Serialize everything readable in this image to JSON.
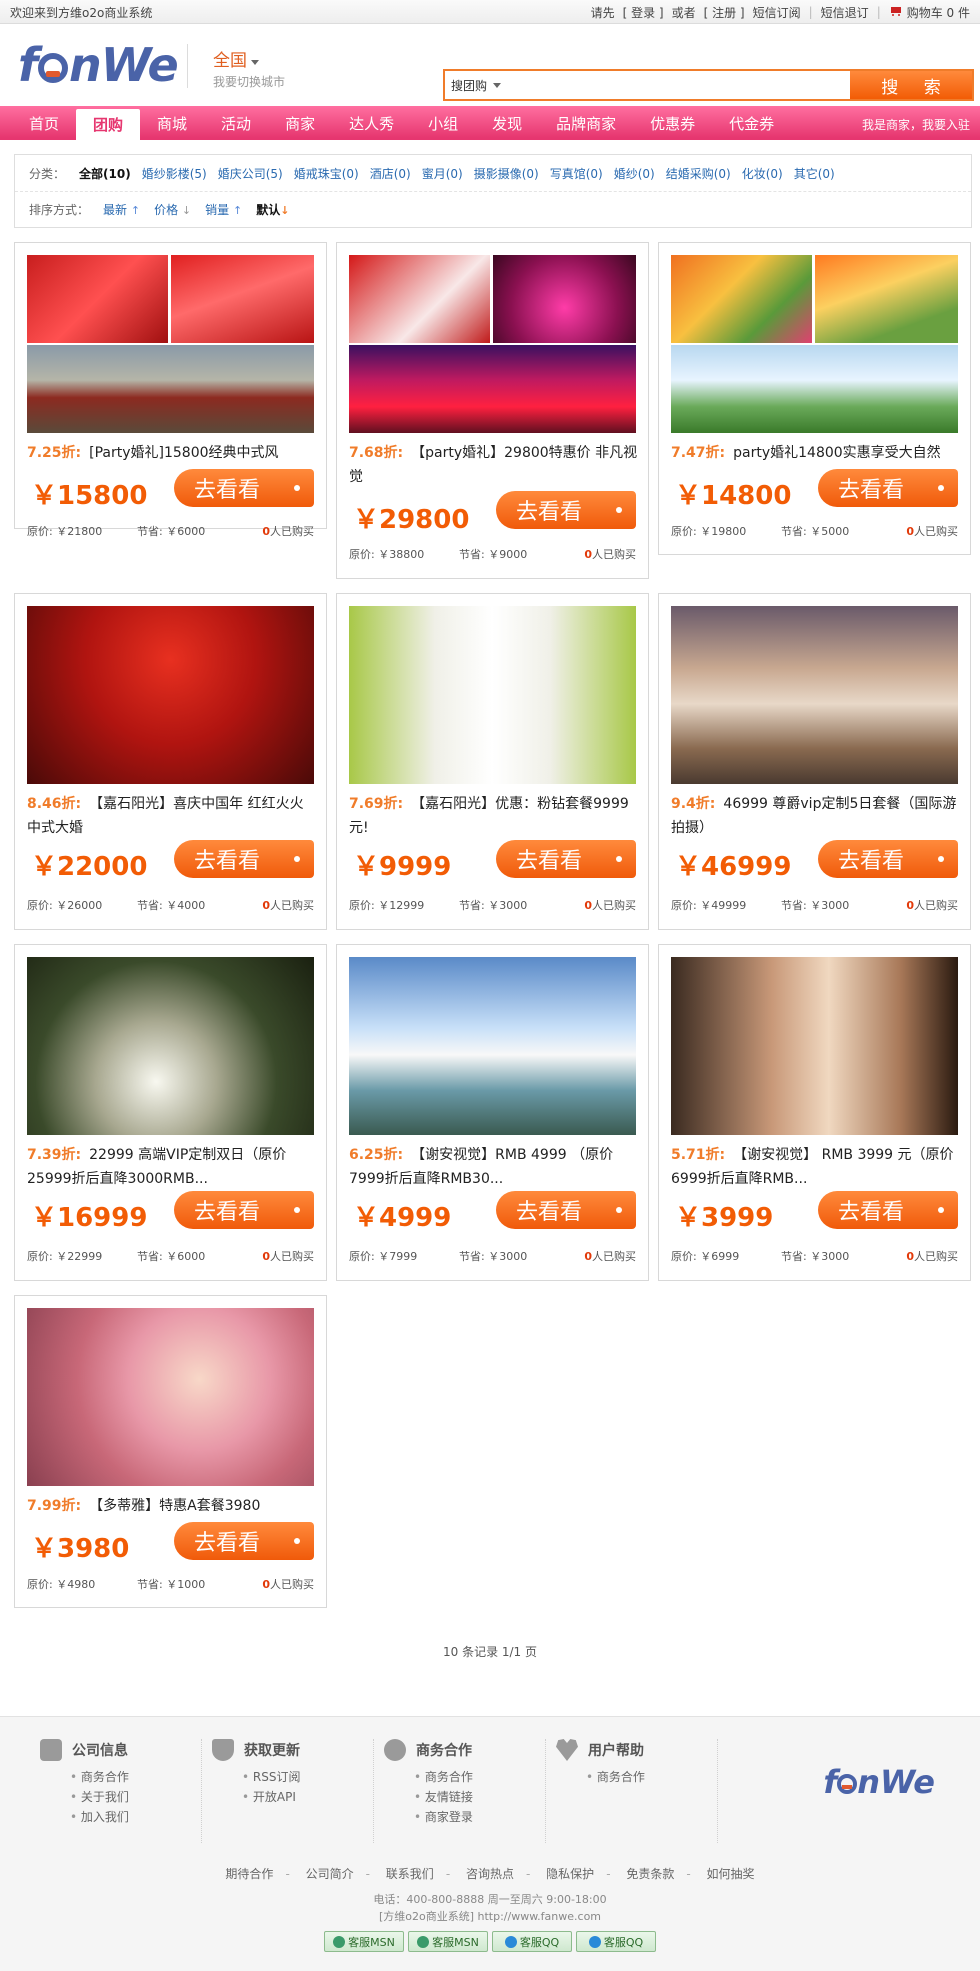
{
  "topbar": {
    "welcome": "欢迎来到方维o2o商业系统",
    "login_prefix": "请先",
    "login": "[ 登录 ]",
    "or": "或者",
    "register": "[ 注册 ]",
    "sms_subscribe": "短信订阅",
    "sms_unsubscribe": "短信退订",
    "cart": "购物车 0 件"
  },
  "header": {
    "logo_text": "fanWe",
    "city": "全国",
    "city_hint": "我要切换城市",
    "search_category": "搜团购",
    "search_value": "",
    "search_button": "搜 索"
  },
  "nav": {
    "items": [
      "首页",
      "团购",
      "商城",
      "活动",
      "商家",
      "达人秀",
      "小组",
      "发现",
      "品牌商家",
      "优惠券",
      "代金券"
    ],
    "active": "团购",
    "merchant_link": "我是商家，我要入驻"
  },
  "filter": {
    "category_label": "分类：",
    "categories": [
      "全部(10)",
      "婚纱影楼(5)",
      "婚庆公司(5)",
      "婚戒珠宝(0)",
      "酒店(0)",
      "蜜月(0)",
      "摄影摄像(0)",
      "写真馆(0)",
      "婚纱(0)",
      "结婚采购(0)",
      "化妆(0)",
      "其它(0)"
    ],
    "sort_label": "排序方式：",
    "sorts": [
      "最新",
      "价格",
      "销量",
      "默认"
    ]
  },
  "deals": [
    {
      "discount": "7.25折:",
      "title": "[Party婚礼]15800经典中式风",
      "price": "￥15800",
      "button": "去看看",
      "orig": "原价: ￥21800",
      "save": "节省: ￥6000",
      "buys_num": "0",
      "buys_text": "人已购买"
    },
    {
      "discount": "7.68折:",
      "title": "【party婚礼】29800特惠价 非凡视觉",
      "price": "￥29800",
      "button": "去看看",
      "orig": "原价: ￥38800",
      "save": "节省: ￥9000",
      "buys_num": "0",
      "buys_text": "人已购买"
    },
    {
      "discount": "7.47折:",
      "title": "party婚礼14800实惠享受大自然",
      "price": "￥14800",
      "button": "去看看",
      "orig": "原价: ￥19800",
      "save": "节省: ￥5000",
      "buys_num": "0",
      "buys_text": "人已购买"
    },
    {
      "discount": "8.46折:",
      "title": "【嘉石阳光】喜庆中国年 红红火火中式大婚",
      "price": "￥22000",
      "button": "去看看",
      "orig": "原价: ￥26000",
      "save": "节省: ￥4000",
      "buys_num": "0",
      "buys_text": "人已购买"
    },
    {
      "discount": "7.69折:",
      "title": "【嘉石阳光】优惠：粉钻套餐9999元!",
      "price": "￥9999",
      "button": "去看看",
      "orig": "原价: ￥12999",
      "save": "节省: ￥3000",
      "buys_num": "0",
      "buys_text": "人已购买"
    },
    {
      "discount": "9.4折:",
      "title": "46999 尊爵vip定制5日套餐（国际游拍摄）",
      "price": "￥46999",
      "button": "去看看",
      "orig": "原价: ￥49999",
      "save": "节省: ￥3000",
      "buys_num": "0",
      "buys_text": "人已购买"
    },
    {
      "discount": "7.39折:",
      "title": "22999 高端VIP定制双日（原价25999折后直降3000RMB...",
      "price": "￥16999",
      "button": "去看看",
      "orig": "原价: ￥22999",
      "save": "节省: ￥6000",
      "buys_num": "0",
      "buys_text": "人已购买"
    },
    {
      "discount": "6.25折:",
      "title": "【谢安视觉】RMB 4999 （原价7999折后直降RMB30...",
      "price": "￥4999",
      "button": "去看看",
      "orig": "原价: ￥7999",
      "save": "节省: ￥3000",
      "buys_num": "0",
      "buys_text": "人已购买"
    },
    {
      "discount": "5.71折:",
      "title": "【谢安视觉】 RMB 3999 元（原价6999折后直降RMB...",
      "price": "￥3999",
      "button": "去看看",
      "orig": "原价: ￥6999",
      "save": "节省: ￥3000",
      "buys_num": "0",
      "buys_text": "人已购买"
    },
    {
      "discount": "7.99折:",
      "title": "【多蒂雅】特惠A套餐3980",
      "price": "￥3980",
      "button": "去看看",
      "orig": "原价: ￥4980",
      "save": "节省: ￥1000",
      "buys_num": "0",
      "buys_text": "人已购买"
    }
  ],
  "pager": "10 条记录 1/1 页",
  "footer": {
    "cols": [
      {
        "title": "公司信息",
        "icon": "question-icon",
        "links": [
          "商务合作",
          "关于我们",
          "加入我们"
        ]
      },
      {
        "title": "获取更新",
        "icon": "shield-icon",
        "links": [
          "RSS订阅",
          "开放API"
        ]
      },
      {
        "title": "商务合作",
        "icon": "dollar-icon",
        "links": [
          "商务合作",
          "友情链接",
          "商家登录"
        ]
      },
      {
        "title": "用户帮助",
        "icon": "heart-icon",
        "links": [
          "商务合作"
        ]
      }
    ],
    "logo": "fanWe",
    "links": [
      "期待合作",
      "公司简介",
      "联系我们",
      "咨询热点",
      "隐私保护",
      "免责条款",
      "如何抽奖"
    ],
    "phone": "电话：400-800-8888 周一至周六 9:00-18:00",
    "site": "[方维o2o商业系统] http://www.fanwe.com",
    "badges": [
      "客服MSN",
      "客服MSN",
      "客服QQ",
      "客服QQ"
    ]
  },
  "colors": {
    "accent_orange": "#f25c05",
    "nav_pink": "#e6366f",
    "link_blue": "#2a6ab0",
    "logo_blue": "#4a63a8"
  }
}
